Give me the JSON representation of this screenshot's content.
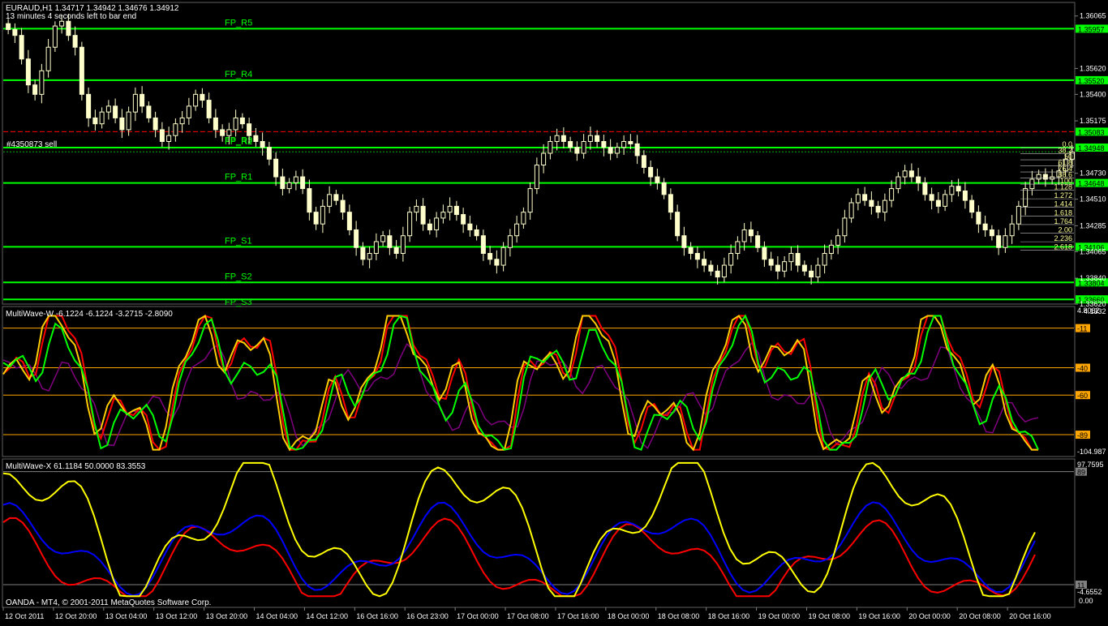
{
  "main_header": {
    "symbol_line": "EURAUD,H1  1.34717 1.34942 1.34676 1.34912",
    "timer_line": "13 minutes 4 seconds left to bar end",
    "order_label": "#4350873 sell"
  },
  "price_axis": {
    "labels": [
      "1.36065",
      "1.35620",
      "1.35400",
      "1.35175",
      "1.34730",
      "1.34510",
      "1.34285",
      "1.34065",
      "1.33840",
      "1.33620"
    ],
    "min": 1.3362,
    "max": 1.3618
  },
  "pivot_levels": [
    {
      "name": "FP_R5",
      "value": "1.35957",
      "price": 1.35957
    },
    {
      "name": "FP_R4",
      "value": "1.35520",
      "price": 1.3552
    },
    {
      "name": "FP_R3",
      "value": "1.35083",
      "price": 1.35083,
      "label_hidden": true
    },
    {
      "name": "FP_R2",
      "value": "1.34948",
      "price": 1.34948
    },
    {
      "name": "FP_R1",
      "value": "1.34648",
      "price": 1.34648
    },
    {
      "name": "FP_S1",
      "value": "1.34106",
      "price": 1.34106
    },
    {
      "name": "FP_S2",
      "value": "1.33804",
      "price": 1.33804
    },
    {
      "name": "FP_S3",
      "value": "1.33660",
      "price": 1.3366
    }
  ],
  "pivot_r3_label": "FP_R3",
  "fib_levels": [
    "0.0",
    "38.2",
    "50",
    "61.8",
    "76.4",
    "88.6",
    "100",
    "1.128",
    "1.272",
    "1.414",
    "1.618",
    "1.764",
    "2.00",
    "2.236",
    "2.618"
  ],
  "indicator_w": {
    "title": "MultiWave-W -6.1224 -6.1224 -3.2715 -2.8090",
    "scale_top": "4.8062",
    "scale_top_overlay": "4.1332",
    "scale_bottom": "-104.987",
    "levels": [
      "-11",
      "-40",
      "-60",
      "-89"
    ]
  },
  "indicator_x": {
    "title": "MultiWave-X 61.1184 50.0000 83.3553",
    "scale_top": "97.7595",
    "scale_bottom": "-4.6552",
    "scale_bottom_overlay": "0.00",
    "levels": [
      "89",
      "11"
    ]
  },
  "footer": {
    "copyright": "OANDA - MT4, © 2001-2011 MetaQuotes Software Corp."
  },
  "time_axis": [
    "12 Oct 2011",
    "12 Oct 20:00",
    "13 Oct 04:00",
    "13 Oct 12:00",
    "13 Oct 20:00",
    "14 Oct 04:00",
    "14 Oct 12:00",
    "16 Oct 16:00",
    "16 Oct 23:00",
    "17 Oct 00:00",
    "17 Oct 08:00",
    "17 Oct 16:00",
    "18 Oct 00:00",
    "18 Oct 08:00",
    "18 Oct 16:00",
    "19 Oct 00:00",
    "19 Oct 08:00",
    "19 Oct 16:00",
    "20 Oct 00:00",
    "20 Oct 08:00",
    "20 Oct 16:00"
  ],
  "colors": {
    "background": "#000000",
    "candle": "#ffffcc",
    "pivot_line": "#00ff00",
    "order_line": "#00ff00",
    "stop_line": "#ff0000",
    "fib": "#ffff00",
    "w_red": "#ff0000",
    "w_orange": "#ffcc00",
    "w_green": "#00ff00",
    "w_purple": "#800080",
    "x_yellow": "#ffff00",
    "x_blue": "#0000ff",
    "x_red": "#ff0000",
    "level_line": "#ffa500"
  }
}
